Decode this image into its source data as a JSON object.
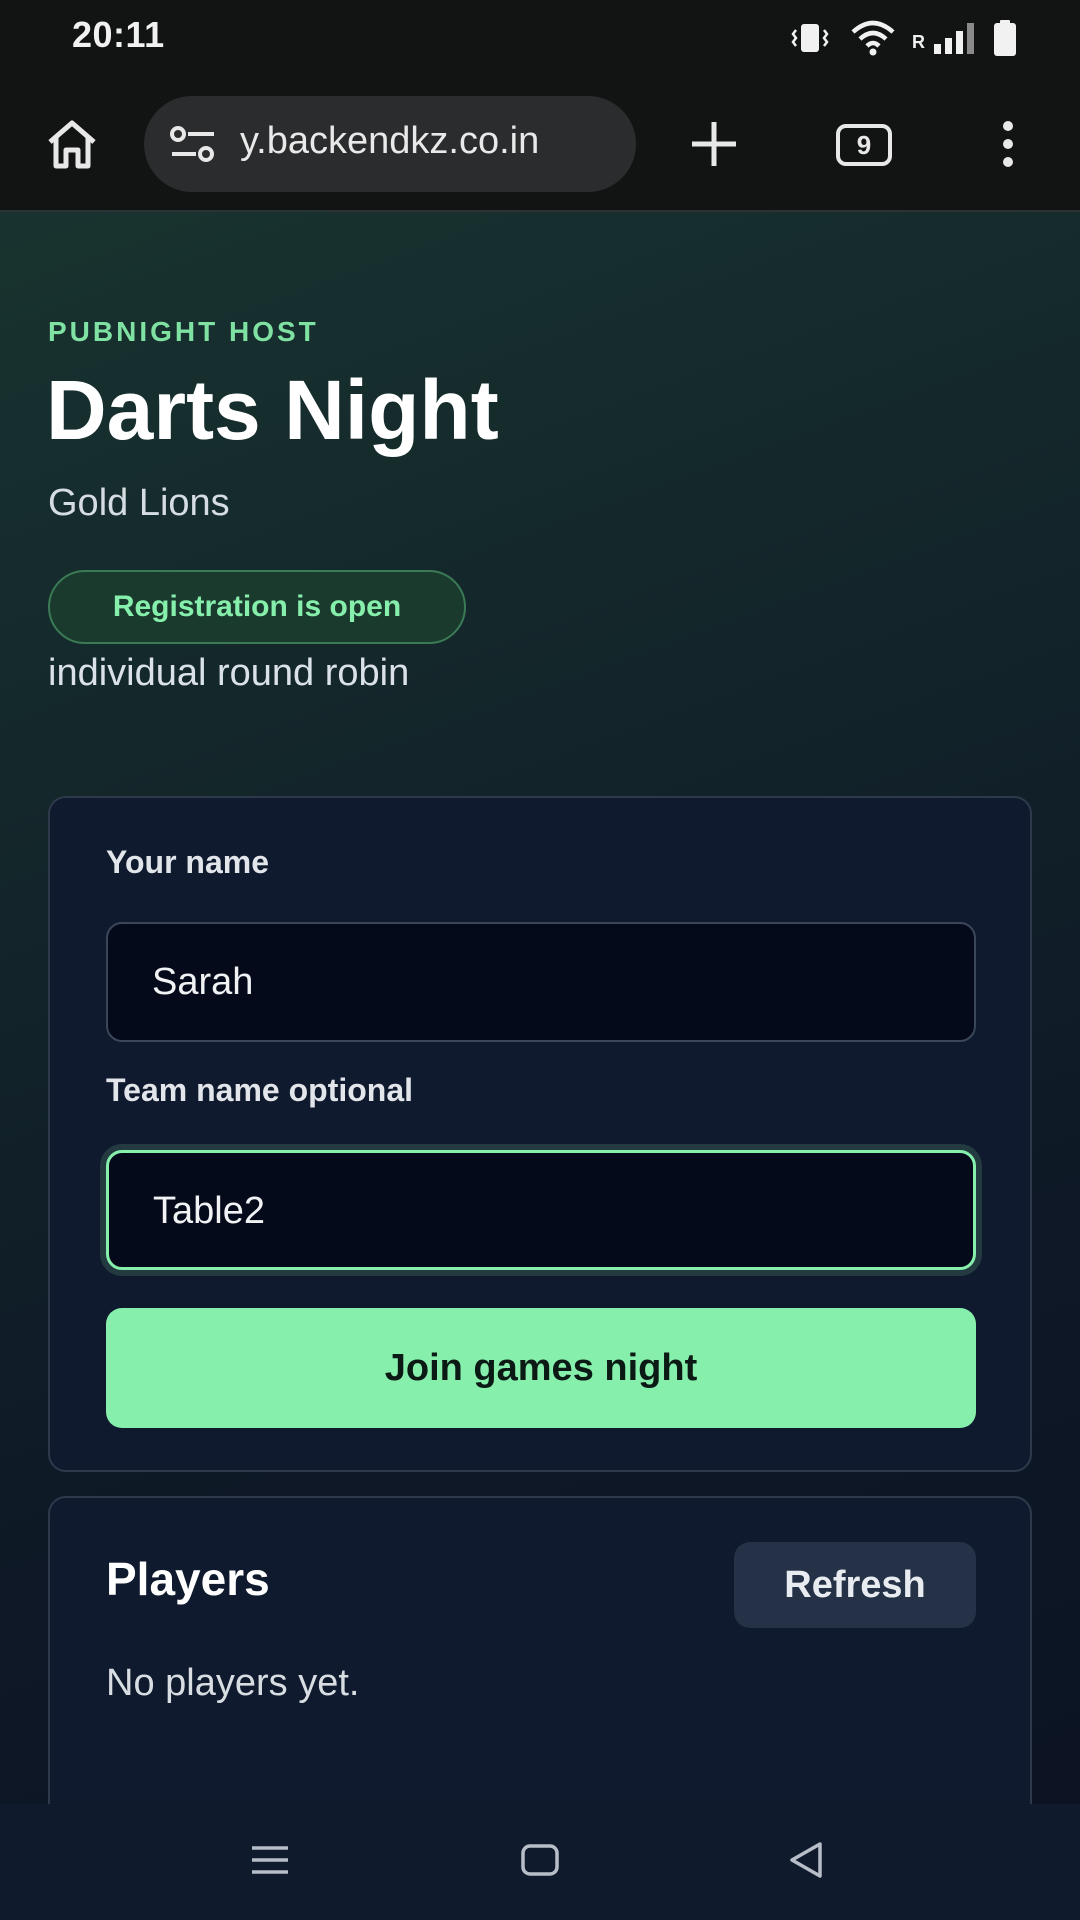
{
  "status_bar": {
    "time": "20:11",
    "roaming_indicator": "R",
    "icons": [
      "vibrate-icon",
      "wifi-icon",
      "signal-icon",
      "battery-icon"
    ]
  },
  "browser": {
    "url": "y.backendkz.co.in",
    "tab_count": "9",
    "icons": [
      "home-icon",
      "site-settings-icon",
      "new-tab-plus-icon",
      "tab-switcher-icon",
      "overflow-menu-icon"
    ]
  },
  "header": {
    "eyebrow": "PUBNIGHT HOST",
    "title": "Darts Night",
    "subtitle": "Gold Lions",
    "status_badge": "Registration is open",
    "format": "individual round robin"
  },
  "form": {
    "name_label": "Your name",
    "name_value": "Sarah",
    "team_label": "Team name optional",
    "team_value": "Table2",
    "join_button": "Join games night"
  },
  "players": {
    "title": "Players",
    "refresh_button": "Refresh",
    "empty_message": "No players yet."
  },
  "colors": {
    "accent": "#86efac",
    "card_bg": "#0f1a2e",
    "input_bg": "#050a1a"
  }
}
